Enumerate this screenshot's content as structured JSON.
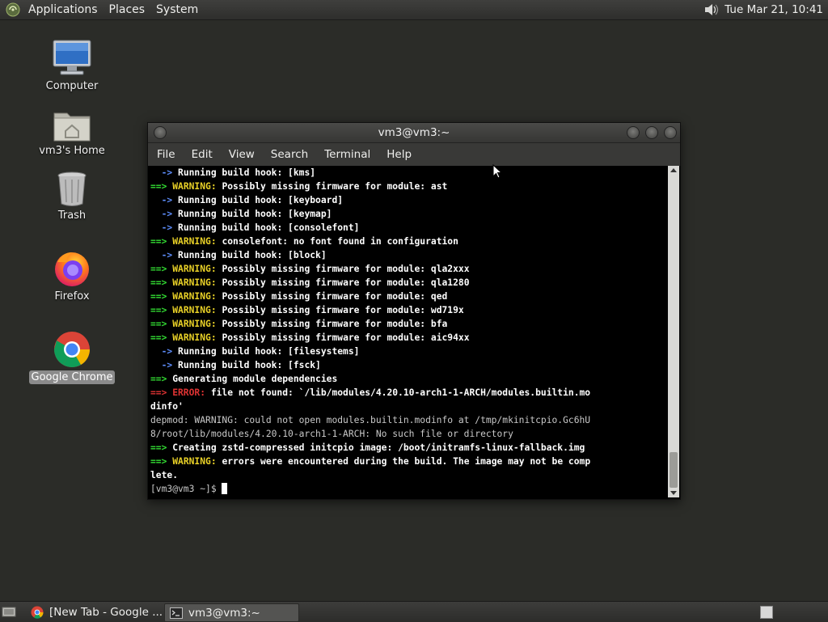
{
  "top_panel": {
    "menus": [
      "Applications",
      "Places",
      "System"
    ],
    "clock": "Tue Mar 21, 10:41"
  },
  "desktop_icons": [
    {
      "label": "Computer",
      "icon": "computer-icon"
    },
    {
      "label": "vm3's Home",
      "icon": "home-folder-icon"
    },
    {
      "label": "Trash",
      "icon": "trash-icon"
    },
    {
      "label": "Firefox",
      "icon": "firefox-icon"
    },
    {
      "label": "Google Chrome",
      "icon": "chrome-icon",
      "selected": true
    }
  ],
  "terminal": {
    "title": "vm3@vm3:~",
    "menu": [
      "File",
      "Edit",
      "View",
      "Search",
      "Terminal",
      "Help"
    ],
    "lines": [
      "  -> Running build hook: [kms]",
      "==> WARNING: Possibly missing firmware for module: ast",
      "  -> Running build hook: [keyboard]",
      "  -> Running build hook: [keymap]",
      "  -> Running build hook: [consolefont]",
      "==> WARNING: consolefont: no font found in configuration",
      "  -> Running build hook: [block]",
      "==> WARNING: Possibly missing firmware for module: qla2xxx",
      "==> WARNING: Possibly missing firmware for module: qla1280",
      "==> WARNING: Possibly missing firmware for module: qed",
      "==> WARNING: Possibly missing firmware for module: wd719x",
      "==> WARNING: Possibly missing firmware for module: bfa",
      "==> WARNING: Possibly missing firmware for module: aic94xx",
      "  -> Running build hook: [filesystems]",
      "  -> Running build hook: [fsck]",
      "==> Generating module dependencies",
      "==> ERROR: file not found: `/lib/modules/4.20.10-arch1-1-ARCH/modules.builtin.mo",
      "dinfo'",
      "depmod: WARNING: could not open modules.builtin.modinfo at /tmp/mkinitcpio.Gc6hU",
      "8/root/lib/modules/4.20.10-arch1-1-ARCH: No such file or directory",
      "==> Creating zstd-compressed initcpio image: /boot/initramfs-linux-fallback.img",
      "==> WARNING: errors were encountered during the build. The image may not be comp",
      "lete.",
      "[vm3@vm3 ~]$ "
    ]
  },
  "taskbar": {
    "tasks": [
      {
        "label": "[New Tab - Google ...",
        "icon": "chrome-icon",
        "active": false
      },
      {
        "label": "vm3@vm3:~",
        "icon": "terminal-icon",
        "active": true
      }
    ]
  },
  "colors": {
    "arrow": "#5f8fff",
    "prefix": "#33dd33",
    "warning": "#e8d027",
    "error": "#e03333",
    "panel": "#3a3a38",
    "desktop": "#2b2c28"
  }
}
